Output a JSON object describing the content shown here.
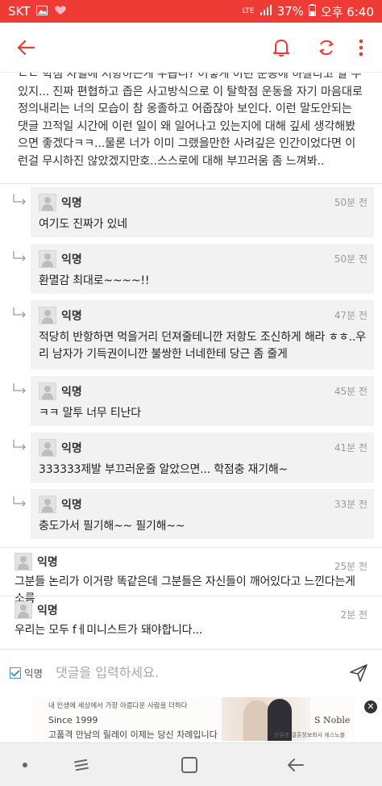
{
  "status_bar": {
    "carrier": "SKT",
    "network": "LTE",
    "battery": "37%",
    "time": "오후 6:40"
  },
  "colors": {
    "accent": "#ef3b36",
    "card_bg": "#f2f2f2"
  },
  "header": {
    "icons": [
      "back-arrow-icon",
      "bell-icon",
      "refresh-icon",
      "more-vert-icon"
    ]
  },
  "main_comment_text": "ㄷㄷ 학점 차별에 저항하는게 우습니? 어떻게 이런 운동에 하잘다고 알 수 있지... 진짜 편협하고 좁은 사고방식으로 이 탈학점 운동을 자기 마음대로 정의내리는 너의 모습이 참 옹졸하고 어줍잖아 보인다. 이런 말도안되는 댓글 끄적일 시간에 이런 일이 왜 일어나고 있는지에 대해 깊세 생각해봤으면 좋겠다ㅋㅋ...물론 너가 이미 그랬을만한 사려깊은 인간이었다면 이런걸 무시하진 않았겠지만호..스스로에 대해 부끄러움 좀 느껴봐..",
  "replies": [
    {
      "nick": "익명",
      "time": "50분 전",
      "text": "여기도 진짜가 있네"
    },
    {
      "nick": "익명",
      "time": "50분 전",
      "text": "환멸감 최대로~~~~!!"
    },
    {
      "nick": "익명",
      "time": "47분 전",
      "text": "적당히 반항하면 먹을거리 던져줄테니깐 저항도 조신하게 해라 ㅎㅎ..우리 남자가 기득권이니깐 불쌍한 너네한테 당근 좀 줄게"
    },
    {
      "nick": "익명",
      "time": "45분 전",
      "text": "ㅋㅋ 말투 너무 티난다"
    },
    {
      "nick": "익명",
      "time": "41분 전",
      "text": "333333제발 부끄러운줄 알았으면... 학점충 재기해~"
    },
    {
      "nick": "익명",
      "time": "33분 전",
      "text": "충도가서 필기해~~ 필기해~~"
    }
  ],
  "comments": [
    {
      "nick": "익명",
      "time": "25분 전",
      "text": "그분들 논리가 이거랑 똑같은데 그분들은 자신들이 깨어있다고 느낀다는게 소름"
    },
    {
      "nick": "익명",
      "time": "2분 전",
      "text": "우리는 모두 fㅔ미니스트가 돼야합니다..."
    }
  ],
  "input_bar": {
    "anon_label": "익명",
    "placeholder": "댓글을 입력하세요."
  },
  "ad": {
    "line1": "내 인생에 세상에서 가장 아름다운 사람을 더하다",
    "line2": "Since 1999",
    "line3": "고품격 만남의 릴레이 이제는 당신 차례입니다",
    "brand": "S Noble",
    "sub": "상류층 결혼정보회사 에스노블"
  }
}
